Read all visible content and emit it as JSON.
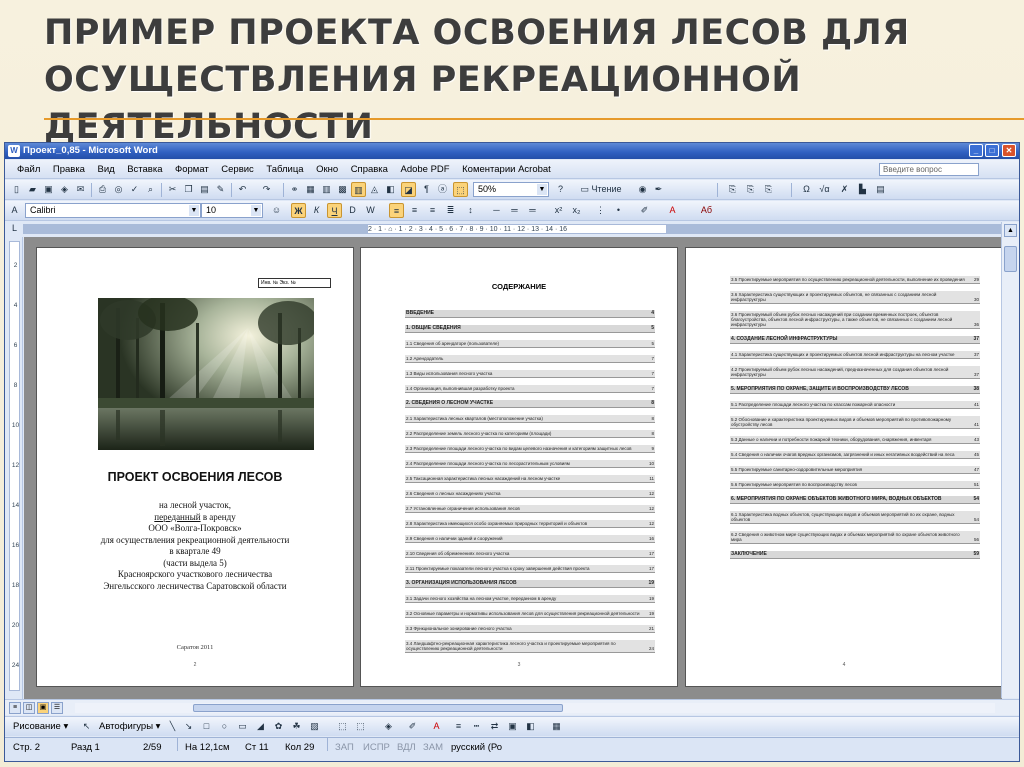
{
  "slide": {
    "title_line1": "ПРИМЕР ПРОЕКТА ОСВОЕНИЯ ЛЕСОВ ДЛЯ",
    "title_line2": "ОСУЩЕСТВЛЕНИЯ  РЕКРЕАЦИОННОЙ ДЕЯТЕЛЬНОСТИ",
    "accent_color": "#e69a2b"
  },
  "window": {
    "title": "Проект_0,85 - Microsoft Word",
    "icon": "word-icon"
  },
  "menu": {
    "items": [
      "Файл",
      "Правка",
      "Вид",
      "Вставка",
      "Формат",
      "Сервис",
      "Таблица",
      "Окно",
      "Справка",
      "Adobe PDF",
      "Коментарии Acrobat"
    ],
    "ask_placeholder": "Введите вопрос"
  },
  "toolbar": {
    "zoom": "50%",
    "reading_label": "Чтение",
    "font": "Calibri",
    "size": "10"
  },
  "ruler": {
    "marks": "2 · 1 · ⌂ · 1 · 2 · 3 · 4 · 5 · 6 · 7 · 8 · 9 · 10 · 11 · 12 · 13 · 14 · 16"
  },
  "page1": {
    "stamp": "Инв. №       Экз. №",
    "title": "ПРОЕКТ ОСВОЕНИЯ ЛЕСОВ",
    "line1": "на лесной участок,",
    "line2a": "переданный",
    "line2b": " в аренду",
    "line3": "ООО «Волга-Покровск»",
    "line4": "для осуществления рекреационной деятельности",
    "line5": "в квартале 49",
    "line6": "(части выдела 5)",
    "line7": "Красноярского участкового лесничества",
    "line8": "Энгельсского лесничества Саратовской области",
    "city": "Саратов 2011",
    "page_num": "2"
  },
  "page2": {
    "heading": "СОДЕРЖАНИЕ",
    "page_num": "3",
    "toc": [
      {
        "t": "ВВЕДЕНИЕ",
        "n": "4",
        "sec": true
      },
      {
        "t": "1. ОБЩИЕ СВЕДЕНИЯ",
        "n": "5",
        "sec": true
      },
      {
        "t": "1.1 Сведения об арендаторе (пользователе)",
        "n": "5"
      },
      {
        "t": "1.2 Арендодатель",
        "n": "7"
      },
      {
        "t": "1.3 Виды использования лесного участка",
        "n": "7"
      },
      {
        "t": "1.4 Организация, выполнившая разработку проекта",
        "n": "7"
      },
      {
        "t": "2. СВЕДЕНИЯ О ЛЕСНОМ УЧАСТКЕ",
        "n": "8",
        "sec": true
      },
      {
        "t": "2.1 Характеристика лесных кварталов (местоположение участка)",
        "n": "8"
      },
      {
        "t": "2.2 Распределение земель лесного участка по категориям (площади)",
        "n": "8"
      },
      {
        "t": "2.3 Распределение площади лесного участка по видам целевого назначения и категориям защитных лесов",
        "n": "9"
      },
      {
        "t": "2.4 Распределение площади лесного участка по лесорастительным условиям",
        "n": "10"
      },
      {
        "t": "2.5 Таксационная характеристика лесных насаждений на лесном участке",
        "n": "11"
      },
      {
        "t": "2.6 Сведения о лесных насаждениях участка",
        "n": "12"
      },
      {
        "t": "2.7 Установленные ограничения использования лесов",
        "n": "12"
      },
      {
        "t": "2.8 Характеристика имеющихся особо охраняемых природных территорий и объектов",
        "n": "12"
      },
      {
        "t": "2.9 Сведения о наличии зданий и сооружений",
        "n": "16"
      },
      {
        "t": "2.10 Сведения об обременениях лесного участка",
        "n": "17"
      },
      {
        "t": "2.11 Проектируемые показатели лесного участка к сроку завершения действия проекта",
        "n": "17"
      },
      {
        "t": "3. ОРГАНИЗАЦИЯ ИСПОЛЬЗОВАНИЯ ЛЕСОВ",
        "n": "19",
        "sec": true
      },
      {
        "t": "3.1 Задачи лесного хозяйства на лесном участке, переданном в аренду",
        "n": "19"
      },
      {
        "t": "3.2 Основные параметры и нормативы использования лесов для осуществления рекреационной деятельности",
        "n": "19"
      },
      {
        "t": "3.3 Функциональное зонирование лесного участка",
        "n": "21"
      },
      {
        "t": "3.4 Ландшафтно-рекреационная характеристика лесного участка и проектируемые мероприятия по осуществлению рекреационной деятельности",
        "n": "24"
      }
    ]
  },
  "page3": {
    "page_num": "4",
    "toc": [
      {
        "t": "3.5 Проектируемые мероприятия по осуществлению рекреационной деятельности, выполнение их проведения",
        "n": "29"
      },
      {
        "t": "3.6 Характеристика существующих и проектируемых объектов, не связанных с созданием лесной инфраструктуры",
        "n": "30"
      },
      {
        "t": "3.6 Проектируемый объем рубок лесных насаждений при создании временных построек, объектов благоустройства, объектов лесной инфраструктуры, а также объектов, не связанных с созданием лесной инфраструктуры",
        "n": "36"
      },
      {
        "t": "4. СОЗДАНИЕ ЛЕСНОЙ ИНФРАСТРУКТУРЫ",
        "n": "37",
        "sec": true
      },
      {
        "t": "4.1 Характеристика существующих и проектируемых объектов лесной инфраструктуры на лесном участке",
        "n": "37"
      },
      {
        "t": "4.2 Проектируемый объем рубок лесных насаждений, предназначенных для создания объектов лесной инфраструктуры",
        "n": "37"
      },
      {
        "t": "5. МЕРОПРИЯТИЯ ПО ОХРАНЕ, ЗАЩИТЕ И ВОСПРОИЗВОДСТВУ ЛЕСОВ",
        "n": "38",
        "sec": true
      },
      {
        "t": "5.1 Распределение площади лесного участка по классам пожарной опасности",
        "n": "41"
      },
      {
        "t": "5.2 Обоснование и характеристика проектируемых видов и объемов мероприятий по противопожарному обустройству лесов",
        "n": "41"
      },
      {
        "t": "5.3 Данные о наличии и потребности пожарной техники, оборудования, снаряжения, инвентаря",
        "n": "43"
      },
      {
        "t": "5.4 Сведения о наличии очагов вредных организмов, загрязнений и иных негативных воздействий на леса",
        "n": "45"
      },
      {
        "t": "5.5 Проектируемые санитарно-оздоровительные мероприятия",
        "n": "47"
      },
      {
        "t": "5.6 Проектируемые мероприятия по воспроизводству лесов",
        "n": "51"
      },
      {
        "t": "6. МЕРОПРИЯТИЯ ПО ОХРАНЕ ОБЪЕКТОВ ЖИВОТНОГО МИРА, ВОДНЫХ ОБЪЕКТОВ",
        "n": "54",
        "sec": true
      },
      {
        "t": "6.1 Характеристика водных объектов, существующих видов и объемов мероприятий по их охране, водных объектов",
        "n": "54"
      },
      {
        "t": "6.2 Сведения о животном мире существующих видах и объемах мероприятий по охране объектов животного мира",
        "n": "56"
      },
      {
        "t": "ЗАКЛЮЧЕНИЕ",
        "n": "59",
        "sec": true
      }
    ]
  },
  "drawing": {
    "draw_label": "Рисование",
    "autoshapes_label": "Автофигуры"
  },
  "status": {
    "page": "Стр. 2",
    "section": "Разд 1",
    "pages": "2/59",
    "at": "На 12,1см",
    "line": "Ст 11",
    "col": "Кол 29",
    "rec": "ЗАП",
    "trk": "ИСПР",
    "ext": "ВДЛ",
    "ovr": "ЗАМ",
    "lang": "русский (Ро"
  }
}
